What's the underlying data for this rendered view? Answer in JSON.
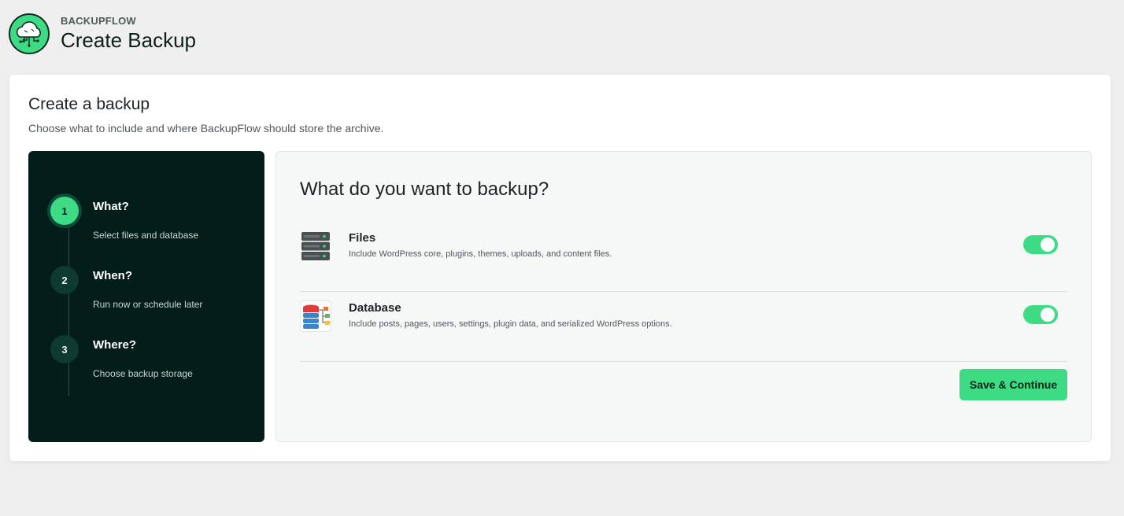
{
  "header": {
    "brand": "BACKUPFLOW",
    "title": "Create Backup",
    "logo_icon": "cloud-circuit-icon"
  },
  "card": {
    "title": "Create a backup",
    "subtitle": "Choose what to include and where BackupFlow should store the archive."
  },
  "steps": [
    {
      "number": "1",
      "title": "What?",
      "description": "Select files and database",
      "active": true
    },
    {
      "number": "2",
      "title": "When?",
      "description": "Run now or schedule later",
      "active": false
    },
    {
      "number": "3",
      "title": "Where?",
      "description": "Choose backup storage",
      "active": false
    }
  ],
  "content": {
    "title": "What do you want to backup?",
    "options": [
      {
        "title": "Files",
        "description": "Include WordPress core, plugins, themes, uploads, and content files.",
        "icon": "server-stack-icon",
        "enabled": true
      },
      {
        "title": "Database",
        "description": "Include posts, pages, users, settings, plugin data, and serialized WordPress options.",
        "icon": "database-icon",
        "enabled": true
      }
    ],
    "save_label": "Save & Continue"
  },
  "colors": {
    "accent": "#3ddc84",
    "sidebar_bg": "#031d1b"
  }
}
